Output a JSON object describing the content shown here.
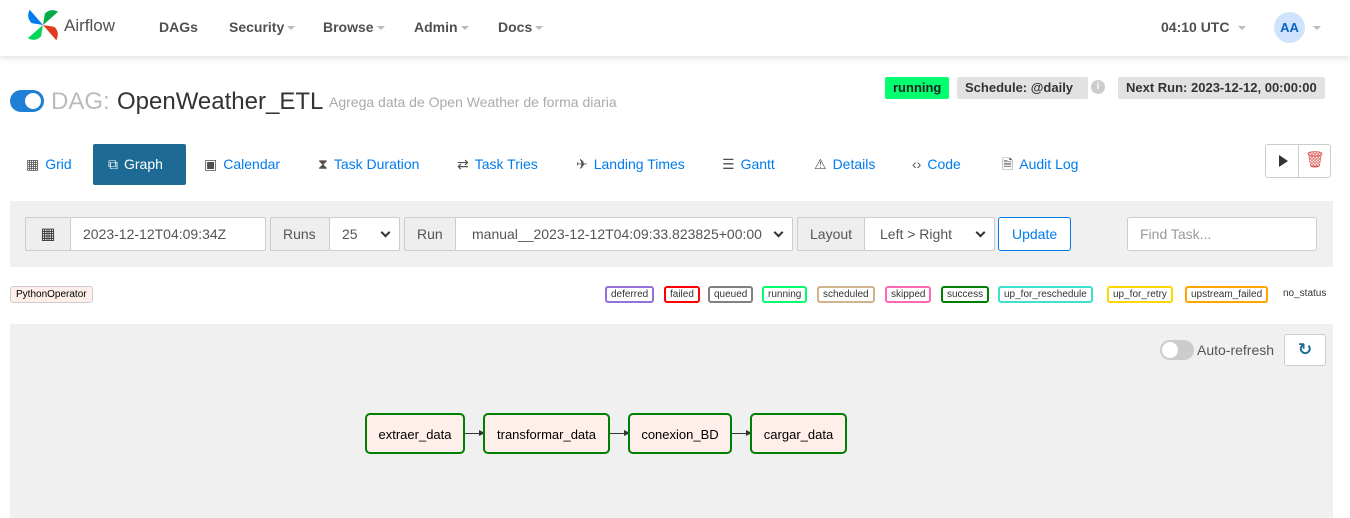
{
  "app": {
    "name": "Airflow"
  },
  "nav": {
    "items": [
      "DAGs",
      "Security",
      "Browse",
      "Admin",
      "Docs"
    ],
    "clock": "04:10 UTC",
    "avatar": "AA"
  },
  "dag": {
    "prefix": "DAG:",
    "id": "OpenWeather_ETL",
    "description": "Agrega data de Open Weather de forma diaria",
    "status": "running",
    "schedule": "Schedule: @daily",
    "next_run": "Next Run: 2023-12-12, 00:00:00",
    "info_icon": "i"
  },
  "tabs": [
    {
      "label": "Grid",
      "icon": "grid-icon"
    },
    {
      "label": "Graph",
      "icon": "graph-icon"
    },
    {
      "label": "Calendar",
      "icon": "calendar-icon"
    },
    {
      "label": "Task Duration",
      "icon": "hourglass-icon"
    },
    {
      "label": "Task Tries",
      "icon": "retry-icon"
    },
    {
      "label": "Landing Times",
      "icon": "plane-landing-icon"
    },
    {
      "label": "Gantt",
      "icon": "gantt-icon"
    },
    {
      "label": "Details",
      "icon": "warning-icon"
    },
    {
      "label": "Code",
      "icon": "code-icon"
    },
    {
      "label": "Audit Log",
      "icon": "search-file-icon"
    }
  ],
  "filters": {
    "date": "2023-12-12T04:09:34Z",
    "runs_label": "Runs",
    "runs_value": "25",
    "run_label": "Run",
    "run_value": "manual__2023-12-12T04:09:33.823825+00:00",
    "layout_label": "Layout",
    "layout_value": "Left > Right",
    "update": "Update",
    "find_placeholder": "Find Task..."
  },
  "legend": {
    "operator": "PythonOperator",
    "states": [
      {
        "label": "deferred",
        "color": "#9370db"
      },
      {
        "label": "failed",
        "color": "#ff0000"
      },
      {
        "label": "queued",
        "color": "#808080"
      },
      {
        "label": "running",
        "color": "#01ff70"
      },
      {
        "label": "scheduled",
        "color": "#d2b48c"
      },
      {
        "label": "skipped",
        "color": "#ff69b4"
      },
      {
        "label": "success",
        "color": "#008000"
      },
      {
        "label": "up_for_reschedule",
        "color": "#40e0d0"
      },
      {
        "label": "up_for_retry",
        "color": "#ffd700"
      },
      {
        "label": "upstream_failed",
        "color": "#ffa500"
      }
    ],
    "no_status": "no_status"
  },
  "graph": {
    "auto_refresh": "Auto-refresh",
    "refresh_icon": "↻",
    "tasks": [
      "extraer_data",
      "transformar_data",
      "conexion_BD",
      "cargar_data"
    ]
  }
}
